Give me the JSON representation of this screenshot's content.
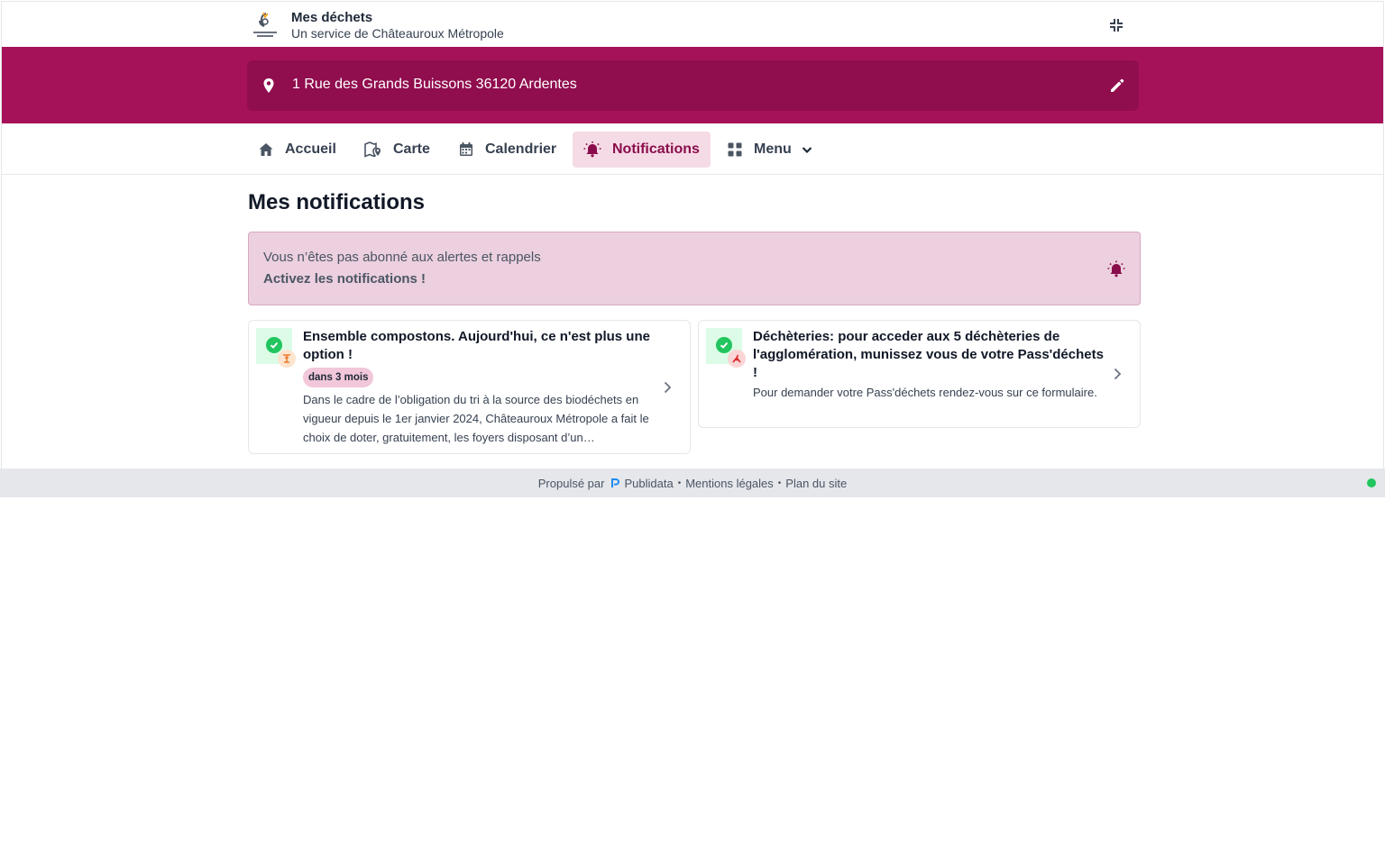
{
  "header": {
    "title": "Mes déchets",
    "subtitle": "Un service de Châteauroux Métropole",
    "logo_icon": "chateauroux-metropole-logo",
    "collapse_icon": "collapse-icon"
  },
  "address": {
    "text": "1 Rue des Grands Buissons 36120 Ardentes",
    "pin_icon": "map-pin-icon",
    "edit_icon": "pencil-icon"
  },
  "nav": {
    "items": [
      {
        "label": "Accueil",
        "icon": "home-icon"
      },
      {
        "label": "Carte",
        "icon": "map-marker-icon"
      },
      {
        "label": "Calendrier",
        "icon": "calendar-icon"
      },
      {
        "label": "Notifications",
        "icon": "bell-alert-icon",
        "active": true
      },
      {
        "label": "Menu",
        "icon": "grid-icon"
      }
    ]
  },
  "main": {
    "title": "Mes notifications",
    "alert": {
      "line1": "Vous n’êtes pas abonné aux alertes et rappels",
      "line2": "Activez les notifications !",
      "icon": "bell-alert-icon"
    },
    "cards": [
      {
        "title": "Ensemble compostons. Aujourd'hui, ce n'est plus une option !",
        "badge": "dans 3 mois",
        "description": "Dans le cadre de l’obligation du tri à la source des biodéchets en vigueur depuis le 1er janvier 2024, Châteauroux Métropole a fait le choix de doter, gratuitement, les foyers disposant d’un…",
        "icon": "check-circle-icon",
        "sub_icon": "compost-icon"
      },
      {
        "title": "Déchèteries: pour acceder aux 5 déchèteries de l'agglomération, munissez vous de votre Pass'déchets !",
        "description": "Pour demander votre Pass'déchets rendez-vous sur ce formulaire.",
        "icon": "check-circle-icon",
        "sub_icon": "recycling-center-icon"
      }
    ]
  },
  "footer": {
    "powered_by": "Propulsé par",
    "brand": "Publidata",
    "legal": "Mentions légales",
    "sitemap": "Plan du site",
    "separator": "•",
    "status_color": "#22c55e"
  },
  "colors": {
    "brand": "#a6125a",
    "brand_dark": "#900d4e",
    "active_bg": "#f5dbe6",
    "alert_bg": "#ecd0df"
  }
}
